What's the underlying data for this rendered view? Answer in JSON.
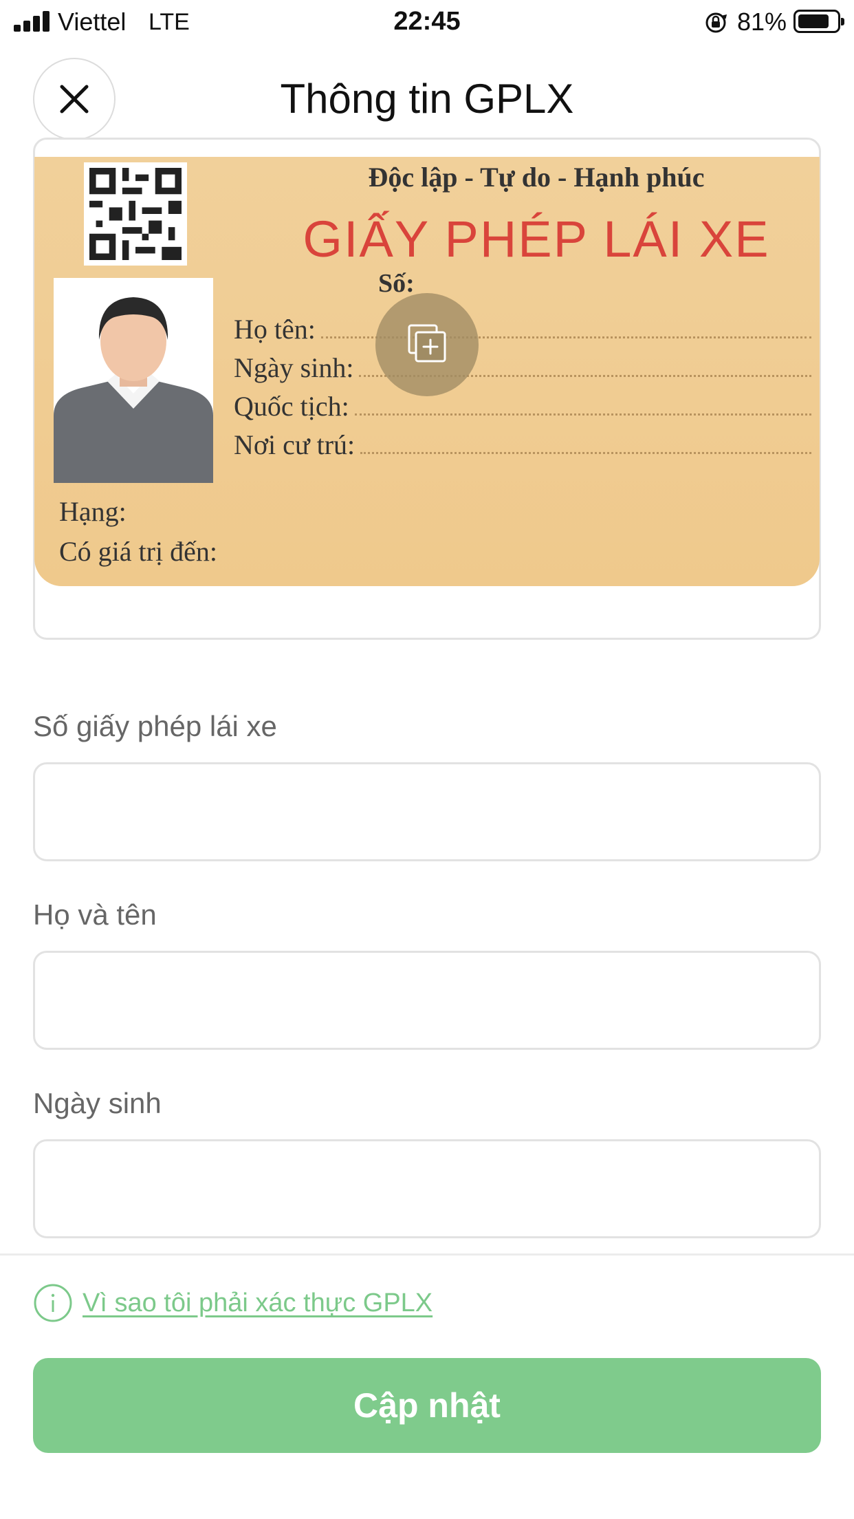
{
  "status_bar": {
    "carrier": "Viettel",
    "network": "LTE",
    "time": "22:45",
    "battery_percent": "81%",
    "battery_level": 0.81
  },
  "header": {
    "close_icon": "close-icon",
    "title": "Thông tin GPLX"
  },
  "license_card": {
    "motto": "Độc lập - Tự do - Hạnh phúc",
    "title": "GIẤY PHÉP LÁI XE",
    "number_label": "Số:",
    "fields": [
      "Họ tên:",
      "Ngày sinh:",
      "Quốc tịch:",
      "Nơi cư trú:"
    ],
    "class_label": "Hạng:",
    "expiry_label": "Có giá trị đến:",
    "upload_icon": "add-photo-icon",
    "colors": {
      "card": "#efc98c",
      "title": "#d9443b"
    }
  },
  "form": {
    "license_number": {
      "label": "Số giấy phép lái xe",
      "value": ""
    },
    "full_name": {
      "label": "Họ và tên",
      "value": ""
    },
    "birth_date": {
      "label": "Ngày sinh",
      "value": ""
    }
  },
  "footer": {
    "info_icon": "info-icon",
    "why_link": "Vì sao tôi phải xác thực GPLX",
    "update_button": "Cập nhật",
    "accent_color": "#7fcb8c"
  }
}
